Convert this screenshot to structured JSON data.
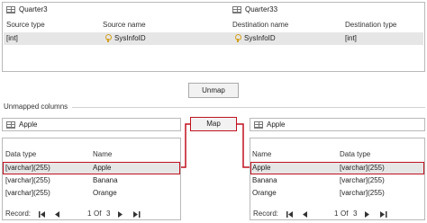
{
  "top": {
    "source_table": "Quarter3",
    "destination_table": "Quarter33",
    "headers": [
      "Source type",
      "Source name",
      "Destination name",
      "Destination type"
    ],
    "mapped_row": {
      "source_type": "[int]",
      "source_name": "SysInfoID",
      "destination_name": "SysInfoID",
      "destination_type": "[int]"
    }
  },
  "unmap_button": "Unmap",
  "map_button": "Map",
  "unmapped": {
    "label": "Unmapped columns",
    "source": {
      "table": "Apple",
      "headers": [
        "Data type",
        "Name"
      ],
      "rows": [
        {
          "type": "[varchar](255)",
          "name": "Apple"
        },
        {
          "type": "[varchar](255)",
          "name": "Banana"
        },
        {
          "type": "[varchar](255)",
          "name": "Orange"
        }
      ],
      "selected_index": 0,
      "record_label": "Record:",
      "record_current": "1",
      "record_of": "Of",
      "record_total": "3"
    },
    "destination": {
      "table": "Apple",
      "headers": [
        "Name",
        "Data type"
      ],
      "rows": [
        {
          "name": "Apple",
          "type": "[varchar](255)"
        },
        {
          "name": "Banana",
          "type": "[varchar](255)"
        },
        {
          "name": "Orange",
          "type": "[varchar](255)"
        }
      ],
      "selected_index": 0,
      "record_label": "Record:",
      "record_current": "1",
      "record_of": "Of",
      "record_total": "3"
    }
  },
  "colors": {
    "highlight_red": "#c0111f",
    "selected_row": "#e6e6e6",
    "border": "#b9b9b9"
  }
}
